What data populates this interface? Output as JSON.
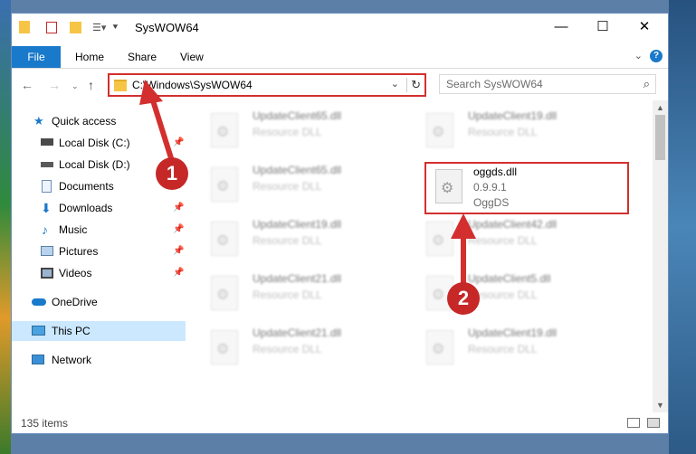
{
  "window": {
    "title": "SysWOW64"
  },
  "ribbon": {
    "file": "File",
    "tabs": [
      "Home",
      "Share",
      "View"
    ]
  },
  "address": {
    "path": "C:\\Windows\\SysWOW64"
  },
  "search": {
    "placeholder": "Search SysWOW64"
  },
  "sidebar": {
    "items": [
      {
        "label": "Quick access",
        "icon": "star-icon"
      },
      {
        "label": "Local Disk (C:)",
        "icon": "drive-icon",
        "pinned": true
      },
      {
        "label": "Local Disk (D:)",
        "icon": "drive-icon"
      },
      {
        "label": "Documents",
        "icon": "documents-icon",
        "pinned": true
      },
      {
        "label": "Downloads",
        "icon": "downloads-icon",
        "pinned": true
      },
      {
        "label": "Music",
        "icon": "music-icon",
        "pinned": true
      },
      {
        "label": "Pictures",
        "icon": "pictures-icon",
        "pinned": true
      },
      {
        "label": "Videos",
        "icon": "videos-icon",
        "pinned": true
      },
      {
        "label": "OneDrive",
        "icon": "cloud-icon"
      },
      {
        "label": "This PC",
        "icon": "pc-icon",
        "selected": true
      },
      {
        "label": "Network",
        "icon": "network-icon"
      }
    ]
  },
  "files": {
    "left": [
      {
        "name": "UpdateClient65.dll",
        "type": "Resource DLL"
      },
      {
        "name": "UpdateClient65.dll",
        "type": "Resource DLL"
      },
      {
        "name": "UpdateClient19.dll",
        "type": "Resource DLL"
      },
      {
        "name": "UpdateClient21.dll",
        "type": "Resource DLL"
      },
      {
        "name": "UpdateClient21.dll",
        "type": "Resource DLL"
      }
    ],
    "right": [
      {
        "name": "UpdateClient19.dll",
        "type": "Resource DLL"
      },
      {
        "name": "UpdateClient42.dll",
        "type": "Resource DLL"
      },
      {
        "name": "UpdateClient5.dll",
        "type": "Resource DLL"
      },
      {
        "name": "UpdateClient19.dll",
        "type": "Resource DLL"
      }
    ],
    "highlighted": {
      "name": "oggds.dll",
      "version": "0.9.9.1",
      "description": "OggDS"
    }
  },
  "status": {
    "count": "135 items"
  },
  "annotations": {
    "badge1": "1",
    "badge2": "2"
  },
  "colors": {
    "accent": "#1979ca",
    "highlight": "#d32f2f",
    "selected": "#cce8ff"
  }
}
